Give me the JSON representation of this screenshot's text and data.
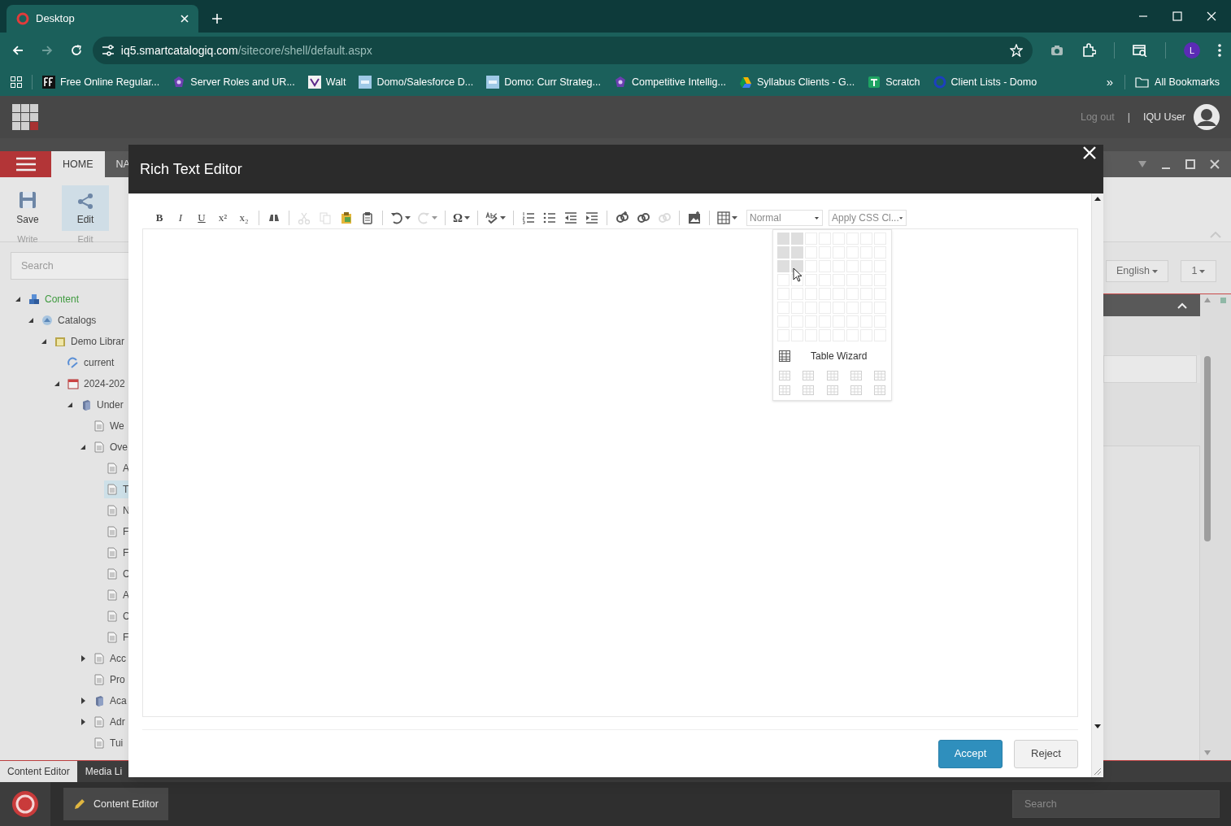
{
  "browser": {
    "tab": {
      "title": "Desktop"
    },
    "url": {
      "host": "iq5.smartcatalogiq.com",
      "path": "/sitecore/shell/default.aspx"
    },
    "profile": "L",
    "bookmarks": [
      {
        "kind": "ff",
        "label": "Free Online Regular..."
      },
      {
        "kind": "gem",
        "label": "Server Roles and UR..."
      },
      {
        "kind": "walt",
        "label": "Walt"
      },
      {
        "kind": "domo",
        "label": "Domo/Salesforce D..."
      },
      {
        "kind": "domo",
        "label": "Domo: Curr Strateg..."
      },
      {
        "kind": "gem",
        "label": "Competitive Intellig..."
      },
      {
        "kind": "drive",
        "label": "Syllabus Clients - G..."
      },
      {
        "kind": "sheets",
        "label": "Scratch"
      },
      {
        "kind": "ring",
        "label": "Client Lists - Domo"
      }
    ],
    "overflow": "»",
    "all_bookmarks": "All Bookmarks"
  },
  "header": {
    "logout": "Log out",
    "separator": "|",
    "user": "IQU User"
  },
  "ribbon": {
    "tabs": [
      {
        "label": "HOME",
        "selected": true
      },
      {
        "label": "NA",
        "selected": false
      }
    ],
    "buttons": [
      {
        "kind": "save",
        "label": "Save",
        "group": "Write",
        "selected": false
      },
      {
        "kind": "edit",
        "label": "Edit",
        "group": "Edit",
        "selected": true
      }
    ]
  },
  "content_tree": {
    "search": {
      "placeholder": "Search"
    },
    "items": [
      {
        "label": "Content",
        "kind": "content",
        "expanded": true,
        "selected": false,
        "children": [
          {
            "label": "Catalogs",
            "kind": "catalogs",
            "expanded": true,
            "selected": false,
            "children": [
              {
                "label": "Demo Librar",
                "kind": "library",
                "expanded": true,
                "selected": false,
                "children": [
                  {
                    "label": "current",
                    "kind": "alias",
                    "selected": false
                  },
                  {
                    "label": "2024-202",
                    "kind": "calendar",
                    "expanded": true,
                    "selected": false,
                    "children": [
                      {
                        "label": "Under",
                        "kind": "book",
                        "expanded": true,
                        "selected": false,
                        "children": [
                          {
                            "label": "We",
                            "kind": "page",
                            "selected": false
                          },
                          {
                            "label": "Ove",
                            "kind": "page",
                            "expanded": true,
                            "selected": false,
                            "children": [
                              {
                                "label": "A",
                                "kind": "page",
                                "selected": false
                              },
                              {
                                "label": "T",
                                "kind": "page",
                                "selected": true
                              },
                              {
                                "label": "N",
                                "kind": "page",
                                "selected": false
                              },
                              {
                                "label": "F",
                                "kind": "page",
                                "selected": false
                              },
                              {
                                "label": "F",
                                "kind": "page",
                                "selected": false
                              },
                              {
                                "label": "C",
                                "kind": "page",
                                "selected": false
                              },
                              {
                                "label": "A",
                                "kind": "page",
                                "selected": false
                              },
                              {
                                "label": "C",
                                "kind": "page",
                                "selected": false
                              },
                              {
                                "label": "F",
                                "kind": "page",
                                "selected": false
                              }
                            ]
                          },
                          {
                            "label": "Acc",
                            "kind": "page",
                            "expanded": false,
                            "selected": false
                          },
                          {
                            "label": "Pro",
                            "kind": "page",
                            "selected": false
                          },
                          {
                            "label": "Aca",
                            "kind": "book",
                            "expanded": false,
                            "selected": false
                          },
                          {
                            "label": "Adr",
                            "kind": "page",
                            "expanded": false,
                            "selected": false
                          },
                          {
                            "label": "Tui",
                            "kind": "page",
                            "selected": false
                          }
                        ]
                      }
                    ]
                  }
                ]
              }
            ]
          }
        ]
      }
    ]
  },
  "right_panel": {
    "language": "English",
    "version": "1"
  },
  "bottom_tabs": [
    {
      "label": "Content Editor",
      "selected": true
    },
    {
      "label": "Media Li",
      "selected": false
    }
  ],
  "taskbar": {
    "app": "Content Editor",
    "search": {
      "placeholder": "Search"
    }
  },
  "dialog": {
    "title": "Rich Text Editor",
    "toolbar_groups": [
      [
        {
          "kind": "text",
          "label": "B",
          "disabled": false
        },
        {
          "kind": "text",
          "label": "I",
          "disabled": false
        },
        {
          "kind": "text",
          "label": "U",
          "disabled": false
        },
        {
          "kind": "text",
          "label": "x²",
          "disabled": false
        },
        {
          "kind": "text",
          "label": "x₂",
          "disabled": false
        }
      ],
      [
        {
          "kind": "find",
          "disabled": false
        }
      ],
      [
        {
          "kind": "cut",
          "disabled": true
        },
        {
          "kind": "copy",
          "disabled": true
        },
        {
          "kind": "paste-word",
          "disabled": false
        },
        {
          "kind": "paste",
          "disabled": false
        }
      ],
      [
        {
          "kind": "undo",
          "disabled": false,
          "dropdown": true
        },
        {
          "kind": "redo",
          "disabled": true,
          "dropdown": true
        }
      ],
      [
        {
          "kind": "symbol",
          "label": "Ω",
          "disabled": false,
          "dropdown": true
        }
      ],
      [
        {
          "kind": "spell",
          "disabled": false,
          "dropdown": true
        }
      ],
      [
        {
          "kind": "ordered-list",
          "disabled": false
        },
        {
          "kind": "bullet-list",
          "disabled": false
        },
        {
          "kind": "outdent",
          "disabled": false
        },
        {
          "kind": "indent",
          "disabled": false
        }
      ],
      [
        {
          "kind": "link-add",
          "disabled": false
        },
        {
          "kind": "link",
          "disabled": false
        },
        {
          "kind": "unlink",
          "disabled": true
        }
      ],
      [
        {
          "kind": "image",
          "disabled": false
        }
      ],
      [
        {
          "kind": "table",
          "disabled": false,
          "dropdown": true
        }
      ]
    ],
    "format_select": "Normal",
    "css_select": "Apply CSS Cl...",
    "table_menu": {
      "grid": [
        [
          true,
          true,
          false,
          false,
          false,
          false,
          false,
          false
        ],
        [
          true,
          true,
          false,
          false,
          false,
          false,
          false,
          false
        ],
        [
          true,
          true,
          false,
          false,
          false,
          false,
          false,
          false
        ],
        [
          false,
          false,
          false,
          false,
          false,
          false,
          false,
          false
        ],
        [
          false,
          false,
          false,
          false,
          false,
          false,
          false,
          false
        ],
        [
          false,
          false,
          false,
          false,
          false,
          false,
          false,
          false
        ],
        [
          false,
          false,
          false,
          false,
          false,
          false,
          false,
          false
        ],
        [
          false,
          false,
          false,
          false,
          false,
          false,
          false,
          false
        ]
      ],
      "wizard": "Table Wizard"
    },
    "buttons": [
      {
        "kind": "primary",
        "label": "Accept"
      },
      {
        "kind": "secondary",
        "label": "Reject"
      }
    ]
  }
}
